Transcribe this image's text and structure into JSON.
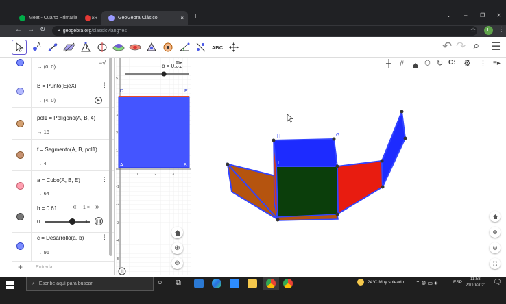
{
  "browser": {
    "tabs": [
      {
        "label": "Meet - Cuarto Primaria",
        "close": "×",
        "color": "#00ac47"
      },
      {
        "label": "",
        "close": "×",
        "color": "#e53935"
      },
      {
        "label": "GeoGebra Clásico",
        "close": "×",
        "color": "#99f"
      }
    ],
    "new_tab": "+",
    "url_host": "geogebra.org",
    "url_path": "/classic?lang=es",
    "profile_initial": "L",
    "window_controls": [
      "⌄",
      "–",
      "❐",
      "✕"
    ]
  },
  "toolbar": {
    "tools": [
      "move-tool-icon",
      "point-tool-icon",
      "line-tool-icon",
      "plane-tool-icon",
      "pyramid-tool-icon",
      "circle-axis-tool-icon",
      "sphere-tool-icon",
      "net-tool-icon",
      "rotate-tool-icon",
      "circle-tool-icon",
      "angle-tool-icon",
      "reflect-tool-icon",
      "text-tool-icon",
      "move-view-tool-icon"
    ],
    "text_tool_label": "ABC",
    "undo": "↶",
    "redo": "↷",
    "search": "⌕",
    "menu": "☰"
  },
  "algebra": {
    "rows": [
      {
        "def": "",
        "val": "→ (0, 0)",
        "color": "#7b8cff",
        "menu": false
      },
      {
        "def": "B = Punto(EjeX)",
        "val": "→ (4, 0)",
        "color": "#b2b8ff",
        "menu": true
      },
      {
        "def": "pol1 = Polígono(A, B, 4)",
        "val": "→ 16",
        "color": "#d3a071",
        "menu": true
      },
      {
        "def": "f = Segmento(A, B, pol1)",
        "val": "→ 4",
        "color": "#c69272",
        "menu": true
      },
      {
        "def": "a = Cubo(A, B, E)",
        "val": "→ 64",
        "color": "#ff9fb0",
        "menu": true
      },
      {
        "def": "b = 0.61",
        "val": "",
        "color": "#777777",
        "menu": false
      },
      {
        "def": "c = Desarrollo(a, b)",
        "val": "→ 96",
        "color": "#7b8cff",
        "menu": true
      }
    ],
    "slider": {
      "min": "0",
      "max": "1",
      "value": 0.61,
      "speed": "1 ×",
      "rew": "«",
      "fwd": "»"
    },
    "input_placeholder": "Entrada...",
    "add": "+",
    "algebra_toggle": "≡√"
  },
  "graphics1": {
    "slider_label": "b = 0.61",
    "x_ticks": [
      "1",
      "2",
      "3"
    ],
    "y_ticks": [
      "5",
      "3",
      "2",
      "1",
      "-1",
      "-2",
      "-3",
      "-4",
      "-5"
    ],
    "points": {
      "A": "A",
      "B": "B",
      "D": "D",
      "E": "E"
    },
    "menu": "≡▸"
  },
  "graphics3d": {
    "points": {
      "H": "H",
      "G": "G",
      "I": "I",
      "J": "J"
    },
    "buttons": [
      "axes-icon",
      "grid-icon",
      "home-icon",
      "cube-view-icon",
      "rotate-view-icon",
      "projection-icon",
      "settings-icon",
      "more-icon",
      "style-bar-icon"
    ]
  },
  "taskbar": {
    "search_placeholder": "Escribe aquí para buscar",
    "weather": "24°C  Muy soleado",
    "lang": "ESP",
    "time": "11:58",
    "date": "21/10/2021"
  },
  "colors": {
    "blue": "#3344ff",
    "red": "#e81c10",
    "brown": "#b5540f",
    "dark_green": "#0b3e0b"
  }
}
